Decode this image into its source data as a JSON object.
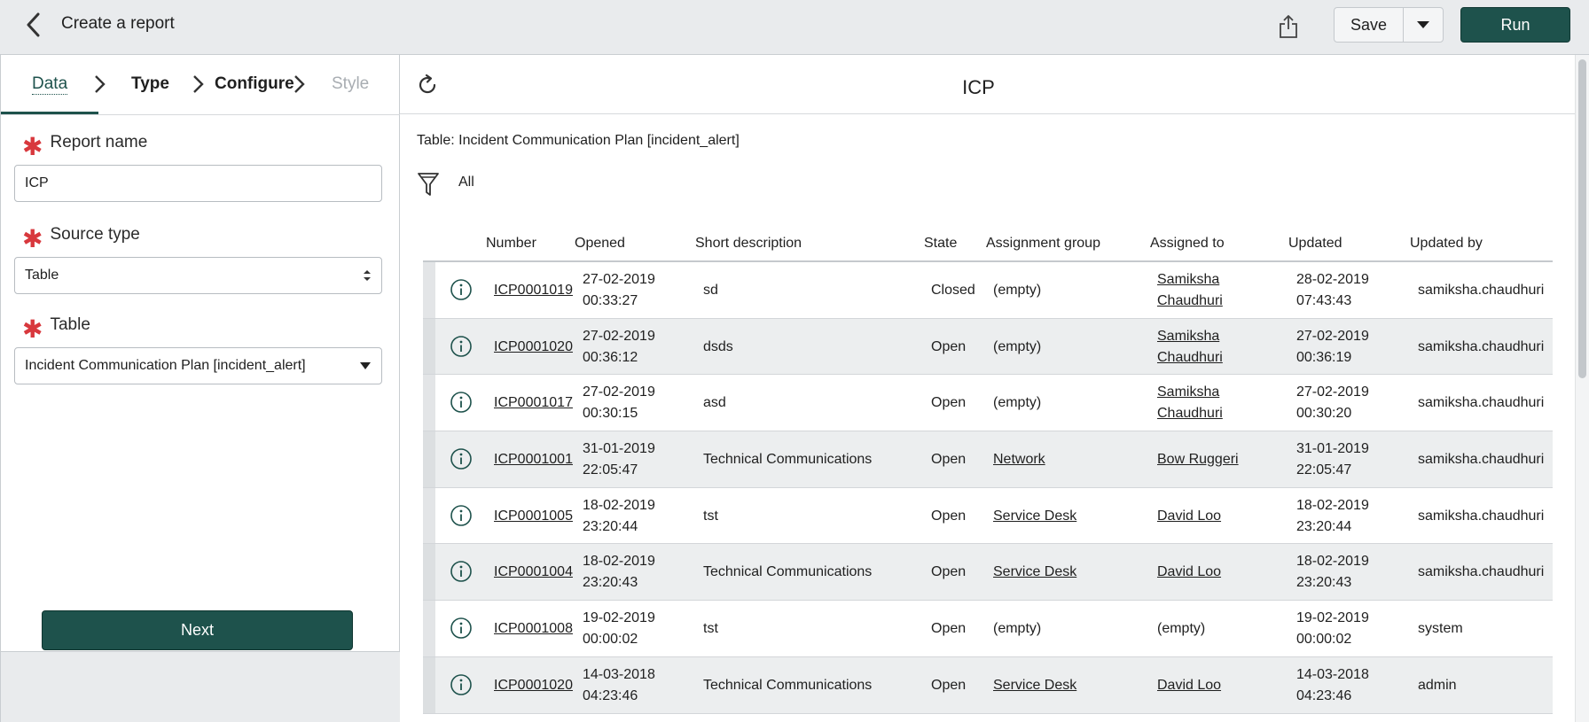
{
  "header": {
    "title": "Create a report",
    "save_label": "Save",
    "run_label": "Run"
  },
  "steps": [
    "Data",
    "Type",
    "Configure",
    "Style"
  ],
  "form": {
    "report_name_label": "Report name",
    "report_name_value": "ICP",
    "source_type_label": "Source type",
    "source_type_value": "Table",
    "table_label": "Table",
    "table_value": "Incident Communication Plan [incident_alert]",
    "next_label": "Next"
  },
  "report": {
    "title": "ICP",
    "table_info": "Table: Incident Communication Plan [incident_alert]",
    "filter": "All"
  },
  "table": {
    "columns": [
      "Number",
      "Opened",
      "Short description",
      "State",
      "Assignment group",
      "Assigned to",
      "Updated",
      "Updated by"
    ],
    "rows": [
      {
        "number": "ICP0001019",
        "opened_date": "27-02-2019",
        "opened_time": "00:33:27",
        "desc": "sd",
        "state": "Closed",
        "group": "(empty)",
        "assigned_1": "Samiksha",
        "assigned_2": "Chaudhuri",
        "updated_date": "28-02-2019",
        "updated_time": "07:43:43",
        "updated_by": "samiksha.chaudhuri"
      },
      {
        "number": "ICP0001020",
        "opened_date": "27-02-2019",
        "opened_time": "00:36:12",
        "desc": "dsds",
        "state": "Open",
        "group": "(empty)",
        "assigned_1": "Samiksha",
        "assigned_2": "Chaudhuri",
        "updated_date": "27-02-2019",
        "updated_time": "00:36:19",
        "updated_by": "samiksha.chaudhuri"
      },
      {
        "number": "ICP0001017",
        "opened_date": "27-02-2019",
        "opened_time": "00:30:15",
        "desc": "asd",
        "state": "Open",
        "group": "(empty)",
        "assigned_1": "Samiksha",
        "assigned_2": "Chaudhuri",
        "updated_date": "27-02-2019",
        "updated_time": "00:30:20",
        "updated_by": "samiksha.chaudhuri"
      },
      {
        "number": "ICP0001001",
        "opened_date": "31-01-2019",
        "opened_time": "22:05:47",
        "desc": "Technical Communications",
        "state": "Open",
        "group": "Network",
        "assigned_1": "Bow Ruggeri",
        "assigned_2": "",
        "updated_date": "31-01-2019",
        "updated_time": "22:05:47",
        "updated_by": "samiksha.chaudhuri"
      },
      {
        "number": "ICP0001005",
        "opened_date": "18-02-2019",
        "opened_time": "23:20:44",
        "desc": "tst",
        "state": "Open",
        "group": "Service Desk",
        "assigned_1": "David Loo",
        "assigned_2": "",
        "updated_date": "18-02-2019",
        "updated_time": "23:20:44",
        "updated_by": "samiksha.chaudhuri"
      },
      {
        "number": "ICP0001004",
        "opened_date": "18-02-2019",
        "opened_time": "23:20:43",
        "desc": "Technical Communications",
        "state": "Open",
        "group": "Service Desk",
        "assigned_1": "David Loo",
        "assigned_2": "",
        "updated_date": "18-02-2019",
        "updated_time": "23:20:43",
        "updated_by": "samiksha.chaudhuri"
      },
      {
        "number": "ICP0001008",
        "opened_date": "19-02-2019",
        "opened_time": "00:00:02",
        "desc": "tst",
        "state": "Open",
        "group": "(empty)",
        "assigned_1": "(empty)",
        "assigned_2": "",
        "updated_date": "19-02-2019",
        "updated_time": "00:00:02",
        "updated_by": "system"
      },
      {
        "number": "ICP0001020",
        "opened_date": "14-03-2018",
        "opened_time": "04:23:46",
        "desc": "Technical Communications",
        "state": "Open",
        "group": "Service Desk",
        "assigned_1": "David Loo",
        "assigned_2": "",
        "updated_date": "14-03-2018",
        "updated_time": "04:23:46",
        "updated_by": "admin"
      }
    ]
  },
  "colors": {
    "accent": "#1e524c",
    "required": "#d8383d",
    "topbar_bg": "#e9ebed"
  },
  "icons": [
    "back-chevron-icon",
    "share-icon",
    "dropdown-caret-icon",
    "refresh-icon",
    "filter-funnel-icon",
    "info-icon",
    "chevron-right-icon",
    "required-asterisk-icon"
  ]
}
